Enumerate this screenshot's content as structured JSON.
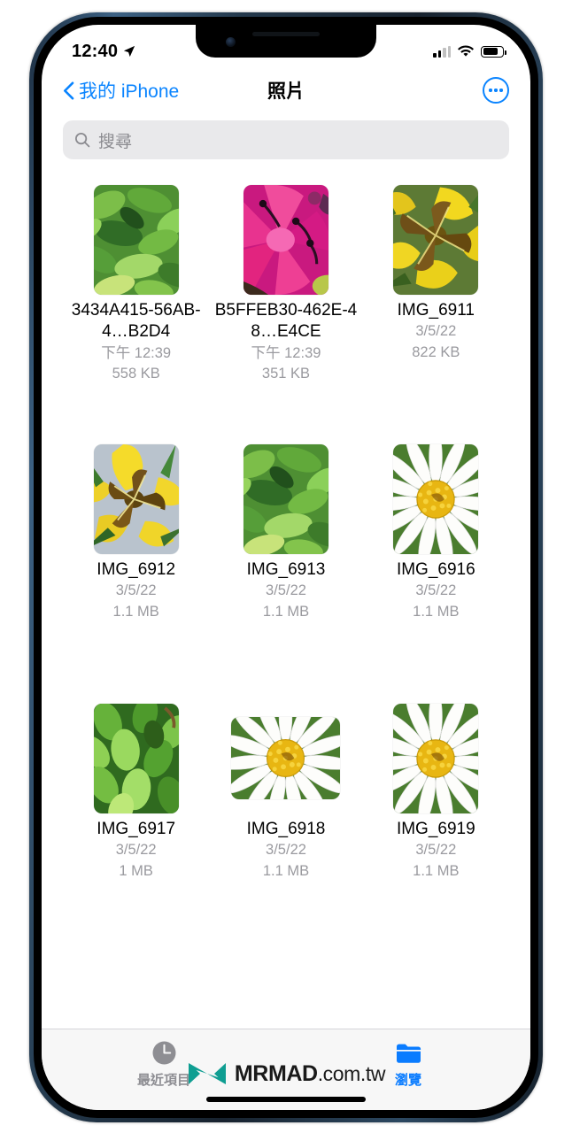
{
  "status_bar": {
    "time": "12:40",
    "location_icon": "location-arrow-icon",
    "signal_icon": "cellular-signal-icon",
    "signal_bars_filled": 2,
    "signal_bars_total": 4,
    "wifi_icon": "wifi-icon",
    "battery_icon": "battery-icon",
    "battery_level_percent": 68
  },
  "nav": {
    "back_label": "我的 iPhone",
    "back_icon": "chevron-left-icon",
    "title": "照片",
    "more_icon": "ellipsis-circle-icon",
    "accent_color": "#0a84ff"
  },
  "search": {
    "placeholder": "搜尋",
    "value": "",
    "icon": "search-icon"
  },
  "files": [
    {
      "name": "3434A415-56AB-4…B2D4",
      "date": "下午 12:39",
      "size": "558 KB",
      "thumb": "green-foliage",
      "shape": "portrait"
    },
    {
      "name": "B5FFEB30-462E-48…E4CE",
      "date": "下午 12:39",
      "size": "351 KB",
      "thumb": "pink-azalea",
      "shape": "portrait"
    },
    {
      "name": "IMG_6911",
      "date": "3/5/22",
      "size": "822 KB",
      "thumb": "yellow-flower",
      "shape": "portrait"
    },
    {
      "name": "IMG_6912",
      "date": "3/5/22",
      "size": "1.1 MB",
      "thumb": "yellow-orchid",
      "shape": "portrait"
    },
    {
      "name": "IMG_6913",
      "date": "3/5/22",
      "size": "1.1 MB",
      "thumb": "green-foliage",
      "shape": "portrait"
    },
    {
      "name": "IMG_6916",
      "date": "3/5/22",
      "size": "1.1 MB",
      "thumb": "white-daisy",
      "shape": "portrait"
    },
    {
      "name": "IMG_6917",
      "date": "3/5/22",
      "size": "1 MB",
      "thumb": "green-leaves",
      "shape": "portrait"
    },
    {
      "name": "IMG_6918",
      "date": "3/5/22",
      "size": "1.1 MB",
      "thumb": "white-daisy",
      "shape": "wide"
    },
    {
      "name": "IMG_6919",
      "date": "3/5/22",
      "size": "1.1 MB",
      "thumb": "white-daisy",
      "shape": "portrait"
    }
  ],
  "tabs": [
    {
      "label": "最近項目",
      "icon": "clock-icon",
      "active": false,
      "color": "#8e8e93"
    },
    {
      "label": "瀏覽",
      "icon": "folder-icon",
      "active": true,
      "color": "#0a7cff"
    }
  ],
  "watermark": {
    "brand": "MRMAD",
    "suffix": ".com.tw",
    "logo_icon": "mrmad-logo-icon",
    "logo_color": "#0f9e92"
  }
}
